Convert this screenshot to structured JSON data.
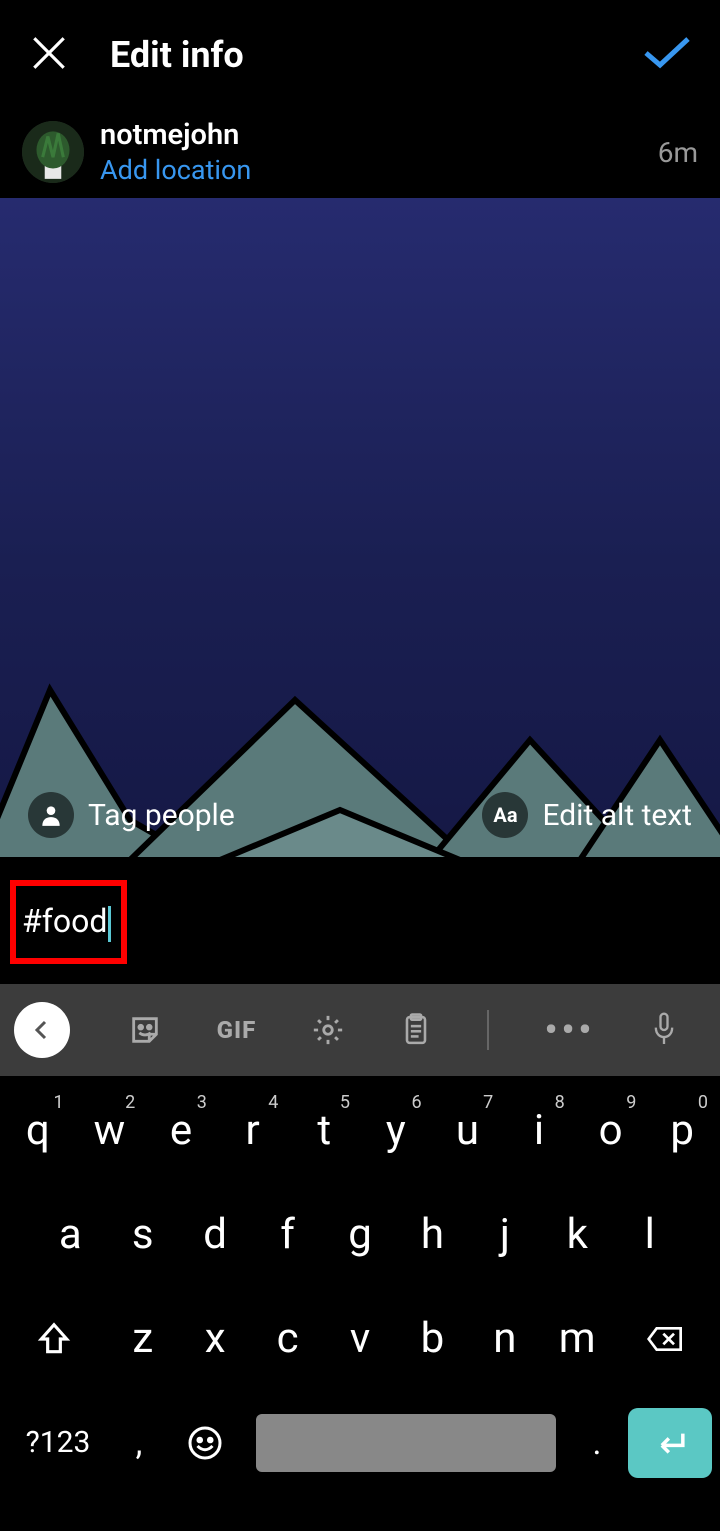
{
  "header": {
    "title": "Edit info"
  },
  "post": {
    "username": "notmejohn",
    "location_prompt": "Add location",
    "timestamp": "6m",
    "tag_label": "Tag people",
    "alt_label": "Edit alt text",
    "caption": "#food"
  },
  "toolbar": {
    "gif": "GIF"
  },
  "keyboard": {
    "row1": [
      {
        "k": "q",
        "n": "1"
      },
      {
        "k": "w",
        "n": "2"
      },
      {
        "k": "e",
        "n": "3"
      },
      {
        "k": "r",
        "n": "4"
      },
      {
        "k": "t",
        "n": "5"
      },
      {
        "k": "y",
        "n": "6"
      },
      {
        "k": "u",
        "n": "7"
      },
      {
        "k": "i",
        "n": "8"
      },
      {
        "k": "o",
        "n": "9"
      },
      {
        "k": "p",
        "n": "0"
      }
    ],
    "row2": [
      "a",
      "s",
      "d",
      "f",
      "g",
      "h",
      "j",
      "k",
      "l"
    ],
    "row3": [
      "z",
      "x",
      "c",
      "v",
      "b",
      "n",
      "m"
    ],
    "numswitch": "?123",
    "comma": ",",
    "period": "."
  }
}
